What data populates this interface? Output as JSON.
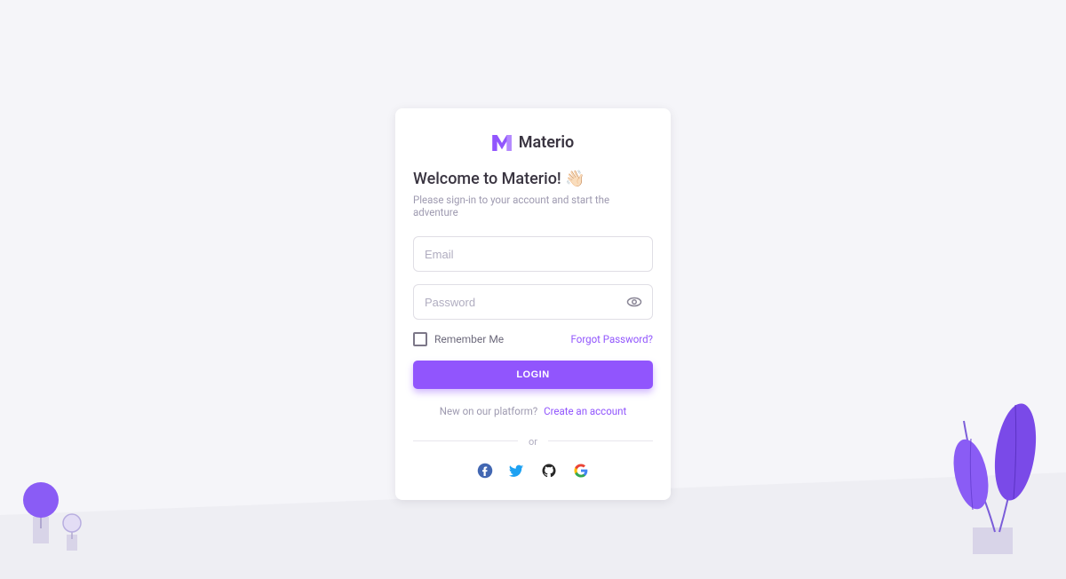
{
  "brand": {
    "name": "Materio"
  },
  "login": {
    "headline": "Welcome to Materio! 👋🏻",
    "subtext": "Please sign-in to your account and start the adventure",
    "email_placeholder": "Email",
    "email_value": "",
    "password_placeholder": "Password",
    "password_value": "",
    "remember_label": "Remember Me",
    "forgot_label": "Forgot Password?",
    "login_button": "LOGIN",
    "signup_text": "New on our platform?",
    "signup_link": "Create an account",
    "divider_label": "or"
  },
  "social": {
    "facebook": "facebook-icon",
    "twitter": "twitter-icon",
    "github": "github-icon",
    "google": "google-icon"
  },
  "colors": {
    "primary": "#9155fd",
    "text_primary": "#3a3541",
    "text_secondary": "#9e9ab0",
    "border": "#e0dee5",
    "background": "#f5f5f9"
  }
}
